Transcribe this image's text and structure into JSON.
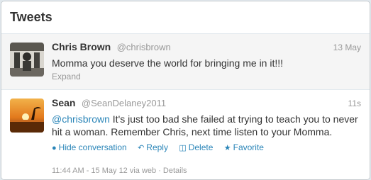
{
  "header": {
    "title": "Tweets"
  },
  "tweets": [
    {
      "fullname": "Chris Brown",
      "username": "@chrisbrown",
      "time": "13 May",
      "text": "Momma you deserve the world for bringing me in it!!!",
      "expand_label": "Expand"
    },
    {
      "fullname": "Sean",
      "username": "@SeanDelaney2011",
      "time": "11s",
      "mention": "@chrisbrown",
      "text": " It's just too bad she failed at trying to teach you to never hit a woman. Remember Chris, next time listen to your Momma.",
      "actions": {
        "hide": "Hide conversation",
        "reply": "Reply",
        "delete": "Delete",
        "favorite": "Favorite"
      },
      "meta": "11:44 AM - 15 May 12 via web · Details"
    }
  ],
  "colors": {
    "link": "#2a85b8",
    "muted": "#999999",
    "text": "#333333"
  }
}
